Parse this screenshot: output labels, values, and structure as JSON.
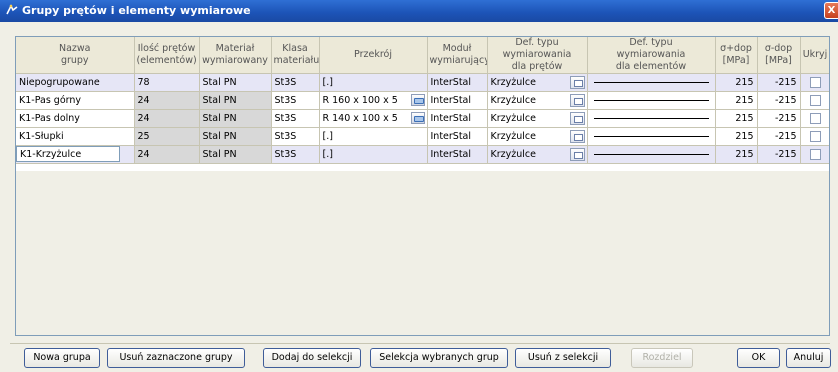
{
  "window": {
    "title": "Grupy prętów i elementy wymiarowe",
    "close_glyph": "X"
  },
  "table": {
    "headers": [
      [
        "Nazwa",
        "grupy"
      ],
      [
        "Ilość prętów",
        "(elementów)"
      ],
      [
        "Materiał",
        "wymiarowany"
      ],
      [
        "Klasa",
        "materiału"
      ],
      [
        "Przekrój"
      ],
      [
        "Moduł",
        "wymiarujący"
      ],
      [
        "Def. typu",
        "wymiarowania",
        "dla prętów"
      ],
      [
        "Def. typu",
        "wymiarowania",
        "dla elementów"
      ],
      [
        "σ+dop",
        "[MPa]"
      ],
      [
        "σ-dop",
        "[MPa]"
      ],
      [
        "Ukryj"
      ]
    ],
    "rows": [
      {
        "name": "Niepogrupowane",
        "count": "78",
        "material": "Stal PN",
        "class": "St3S",
        "section": "[.]",
        "module": "InterStal",
        "type": "Krzyżulce",
        "s_plus": "215",
        "s_minus": "-215"
      },
      {
        "name": "K1-Pas górny",
        "count": "24",
        "material": "Stal PN",
        "class": "St3S",
        "section": "R 160 x 100 x 5",
        "module": "InterStal",
        "type": "Krzyżulce",
        "s_plus": "215",
        "s_minus": "-215"
      },
      {
        "name": "K1-Pas dolny",
        "count": "24",
        "material": "Stal PN",
        "class": "St3S",
        "section": "R 140 x 100 x 5",
        "module": "InterStal",
        "type": "Krzyżulce",
        "s_plus": "215",
        "s_minus": "-215"
      },
      {
        "name": "K1-Słupki",
        "count": "25",
        "material": "Stal PN",
        "class": "St3S",
        "section": "[.]",
        "module": "InterStal",
        "type": "Krzyżulce",
        "s_plus": "215",
        "s_minus": "-215"
      },
      {
        "name": "K1-Krzyżulce",
        "count": "24",
        "material": "Stal PN",
        "class": "St3S",
        "section": "[.]",
        "module": "InterStal",
        "type": "Krzyżulce",
        "s_plus": "215",
        "s_minus": "-215"
      }
    ]
  },
  "buttons": {
    "new_group": "Nowa grupa",
    "delete_selected": "Usuń zaznaczone grupy",
    "add_to_selection": "Dodaj do selekcji",
    "select_groups": "Selekcja wybranych grup",
    "remove_from_selection": "Usuń z selekcji",
    "split": "Rozdziel",
    "ok": "OK",
    "cancel": "Anuluj"
  }
}
